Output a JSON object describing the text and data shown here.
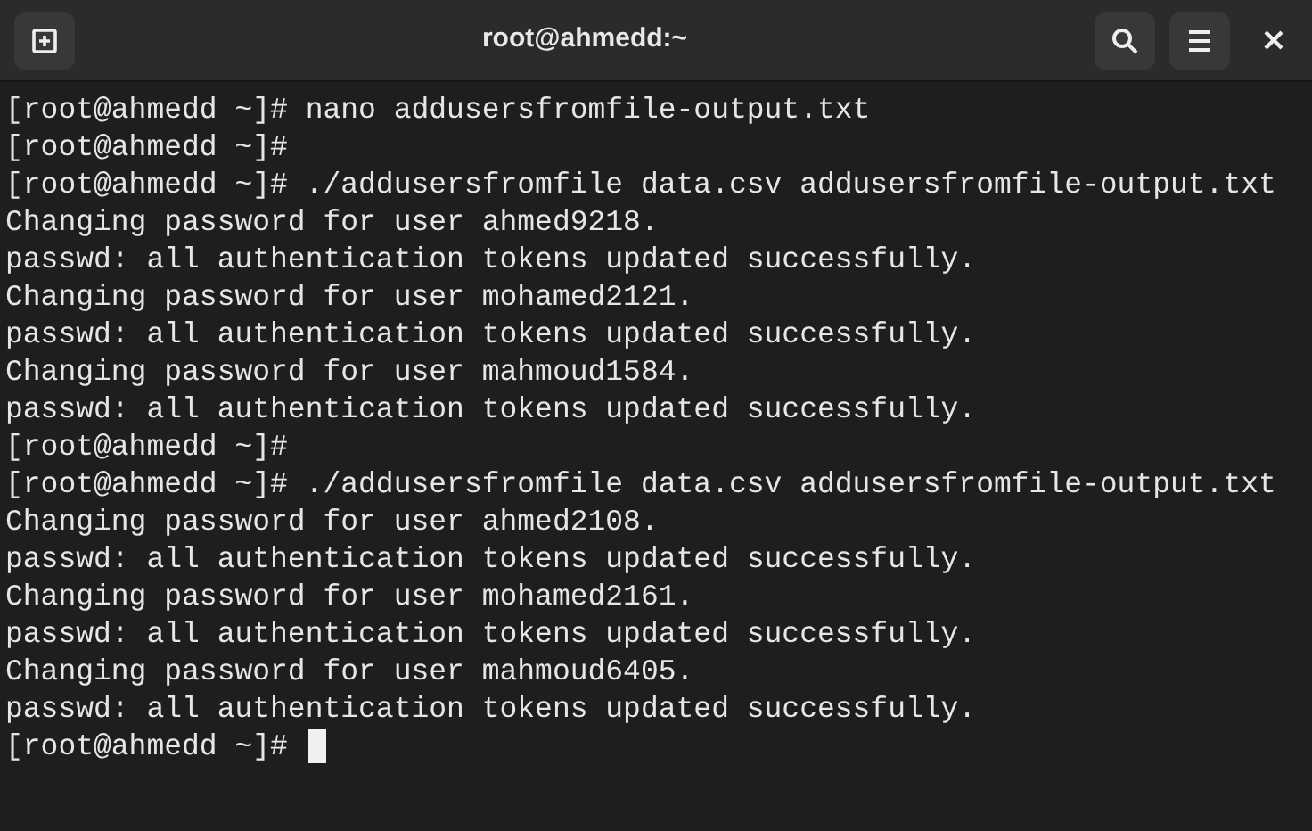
{
  "window": {
    "title": "root@ahmedd:~"
  },
  "terminal": {
    "lines": [
      "[root@ahmedd ~]# nano addusersfromfile-output.txt",
      "[root@ahmedd ~]#",
      "[root@ahmedd ~]# ./addusersfromfile data.csv addusersfromfile-output.txt",
      "Changing password for user ahmed9218.",
      "passwd: all authentication tokens updated successfully.",
      "Changing password for user mohamed2121.",
      "passwd: all authentication tokens updated successfully.",
      "Changing password for user mahmoud1584.",
      "passwd: all authentication tokens updated successfully.",
      "[root@ahmedd ~]#",
      "[root@ahmedd ~]# ./addusersfromfile data.csv addusersfromfile-output.txt",
      "Changing password for user ahmed2108.",
      "passwd: all authentication tokens updated successfully.",
      "Changing password for user mohamed2161.",
      "passwd: all authentication tokens updated successfully.",
      "Changing password for user mahmoud6405.",
      "passwd: all authentication tokens updated successfully.",
      "[root@ahmedd ~]#"
    ],
    "cursor": true
  }
}
